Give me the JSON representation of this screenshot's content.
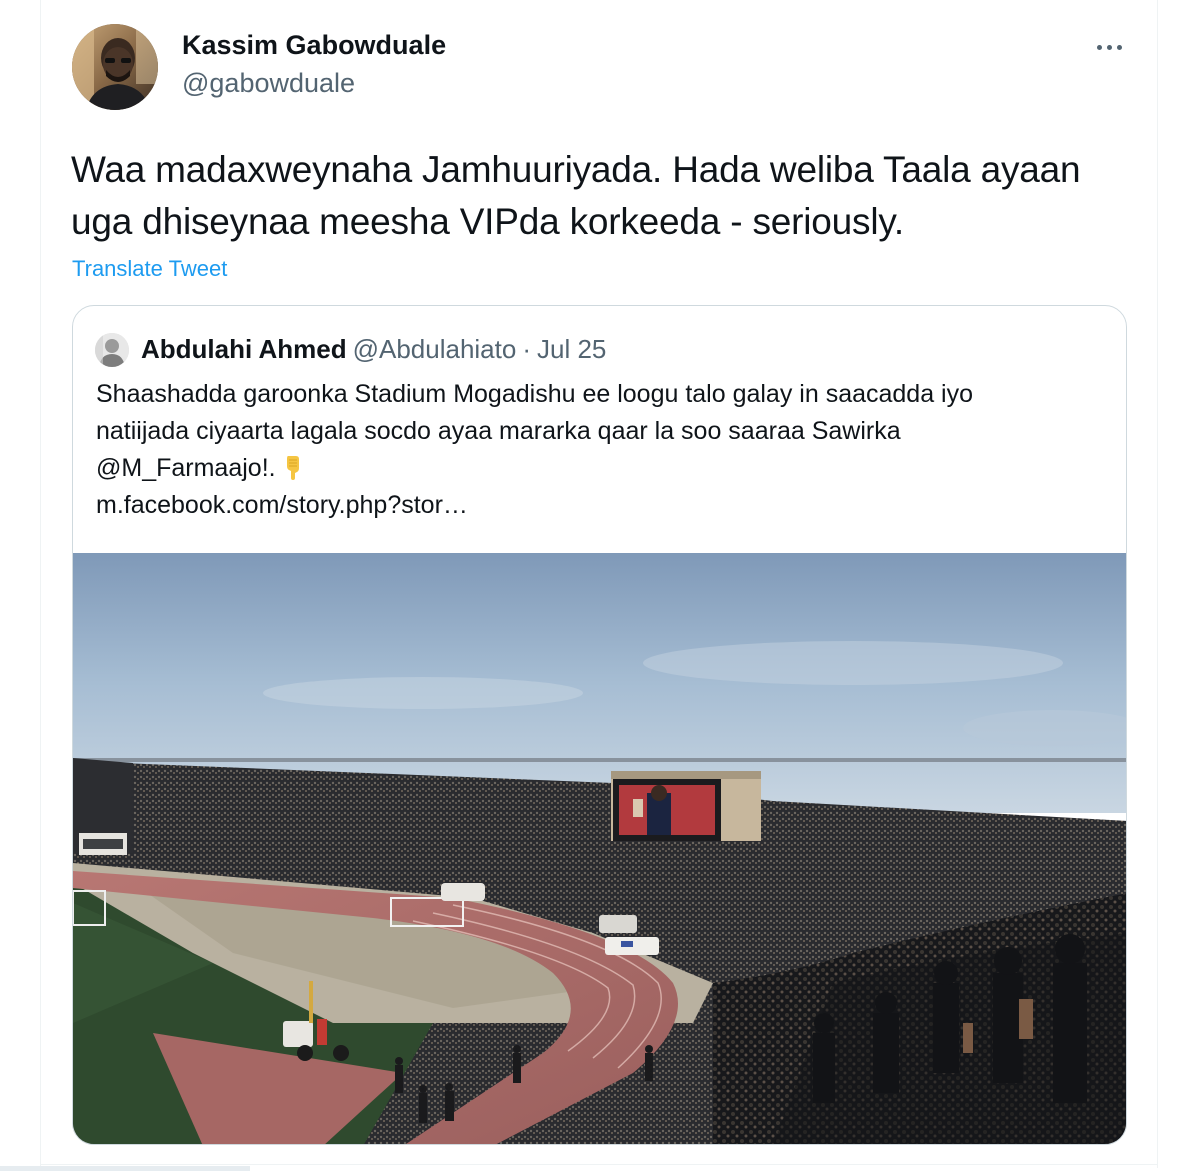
{
  "tweet": {
    "author": {
      "display_name": "Kassim Gabowduale",
      "handle": "@gabowduale"
    },
    "text": "Waa madaxweynaha Jamhuuriyada. Hada weliba Taala ayaan uga dhiseynaa meesha VIPda korkeeda - seriously.",
    "translate_label": "Translate Tweet",
    "more_icon": "ellipsis-icon"
  },
  "quoted_tweet": {
    "display_name": "Abdulahi Ahmed",
    "handle": "@Abdulahiato",
    "separator": "·",
    "date": "Jul 25",
    "text_lines": [
      "Shaashadda garoonka Stadium Mogadishu ee loogu talo galay in saacadda iyo",
      "natiijada ciyaarta lagala socdo ayaa mararka qaar la soo saaraa Sawirka",
      "@M_Farmaajo!.",
      "m.facebook.com/story.php?stor…"
    ],
    "emoji_icon": "backhand-index-pointing-down-icon"
  },
  "colors": {
    "text_primary": "#0f1419",
    "text_secondary": "#536471",
    "link": "#1d9bf0",
    "border": "#cfd9de"
  }
}
